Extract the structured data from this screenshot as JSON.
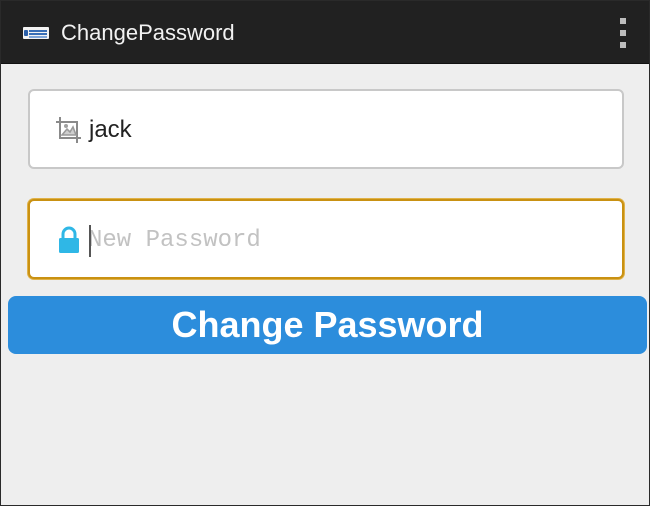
{
  "action_bar": {
    "title": "ChangePassword",
    "app_icon": "app-logo-icon",
    "overflow_icon": "overflow-menu-icon",
    "background_color": "#212121"
  },
  "form": {
    "username": {
      "value": "jack",
      "icon": "crop-image-icon"
    },
    "new_password": {
      "placeholder": "New Password",
      "value": "",
      "icon": "lock-icon",
      "focused": true,
      "focus_color": "#c99112"
    },
    "submit_label": "Change Password",
    "submit_color": "#2c8ddc"
  },
  "colors": {
    "page_background": "#eeeeee",
    "lock_icon": "#2fb7e6"
  }
}
